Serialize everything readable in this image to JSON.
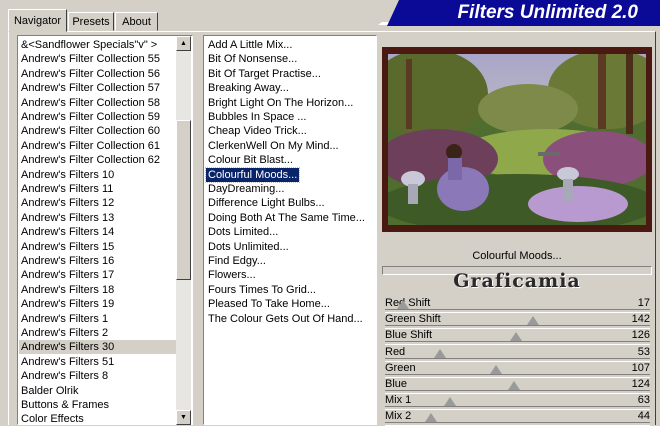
{
  "title": "Filters Unlimited 2.0",
  "tabs": [
    {
      "label": "Navigator",
      "active": true
    },
    {
      "label": "Presets",
      "active": false
    },
    {
      "label": "About",
      "active": false
    }
  ],
  "categories": [
    "&<Sandflower Specials\"v\" >",
    "Andrew's Filter Collection 55",
    "Andrew's Filter Collection 56",
    "Andrew's Filter Collection 57",
    "Andrew's Filter Collection 58",
    "Andrew's Filter Collection 59",
    "Andrew's Filter Collection 60",
    "Andrew's Filter Collection 61",
    "Andrew's Filter Collection 62",
    "Andrew's Filters 10",
    "Andrew's Filters 11",
    "Andrew's Filters 12",
    "Andrew's Filters 13",
    "Andrew's Filters 14",
    "Andrew's Filters 15",
    "Andrew's Filters 16",
    "Andrew's Filters 17",
    "Andrew's Filters 18",
    "Andrew's Filters 19",
    "Andrew's Filters 1",
    "Andrew's Filters 2",
    "Andrew's Filters 30",
    "Andrew's Filters 51",
    "Andrew's Filters 8",
    "Balder Olrik",
    "Buttons & Frames",
    "Color Effects"
  ],
  "selected_category": "Andrew's Filters 30",
  "filters": [
    "Add A Little Mix...",
    "Bit Of Nonsense...",
    "Bit Of Target Practise...",
    "Breaking Away...",
    "Bright Light On The Horizon...",
    "Bubbles In Space ...",
    "Cheap Video Trick...",
    "ClerkenWell On My Mind...",
    "Colour Bit Blast...",
    "Colourful Moods...",
    "DayDreaming...",
    "Difference Light Bulbs...",
    "Doing Both At The Same Time...",
    "Dots Limited...",
    "Dots Unlimited...",
    "Find Edgy...",
    "Flowers...",
    "Fours Times To Grid...",
    "Pleased To Take Home...",
    "The Colour Gets Out Of Hand..."
  ],
  "selected_filter": "Colourful Moods...",
  "preview_label": "Colourful Moods...",
  "watermark": "Graficamia",
  "sliders": [
    {
      "label": "Red Shift",
      "value": "17",
      "max": 255
    },
    {
      "label": "Green Shift",
      "value": "142",
      "max": 255
    },
    {
      "label": "Blue Shift",
      "value": "126",
      "max": 255
    },
    {
      "label": "Red",
      "value": "53",
      "max": 255
    },
    {
      "label": "Green",
      "value": "107",
      "max": 255
    },
    {
      "label": "Blue",
      "value": "124",
      "max": 255
    },
    {
      "label": "Mix 1",
      "value": "63",
      "max": 255
    },
    {
      "label": "Mix 2",
      "value": "44",
      "max": 255
    }
  ],
  "icons": {
    "scroll_up": "arrow-up-icon",
    "scroll_down": "arrow-down-icon"
  },
  "colors": {
    "banner": "#0a0a96",
    "selection": "#0a246a",
    "preview_frame": "#4a1a12"
  }
}
